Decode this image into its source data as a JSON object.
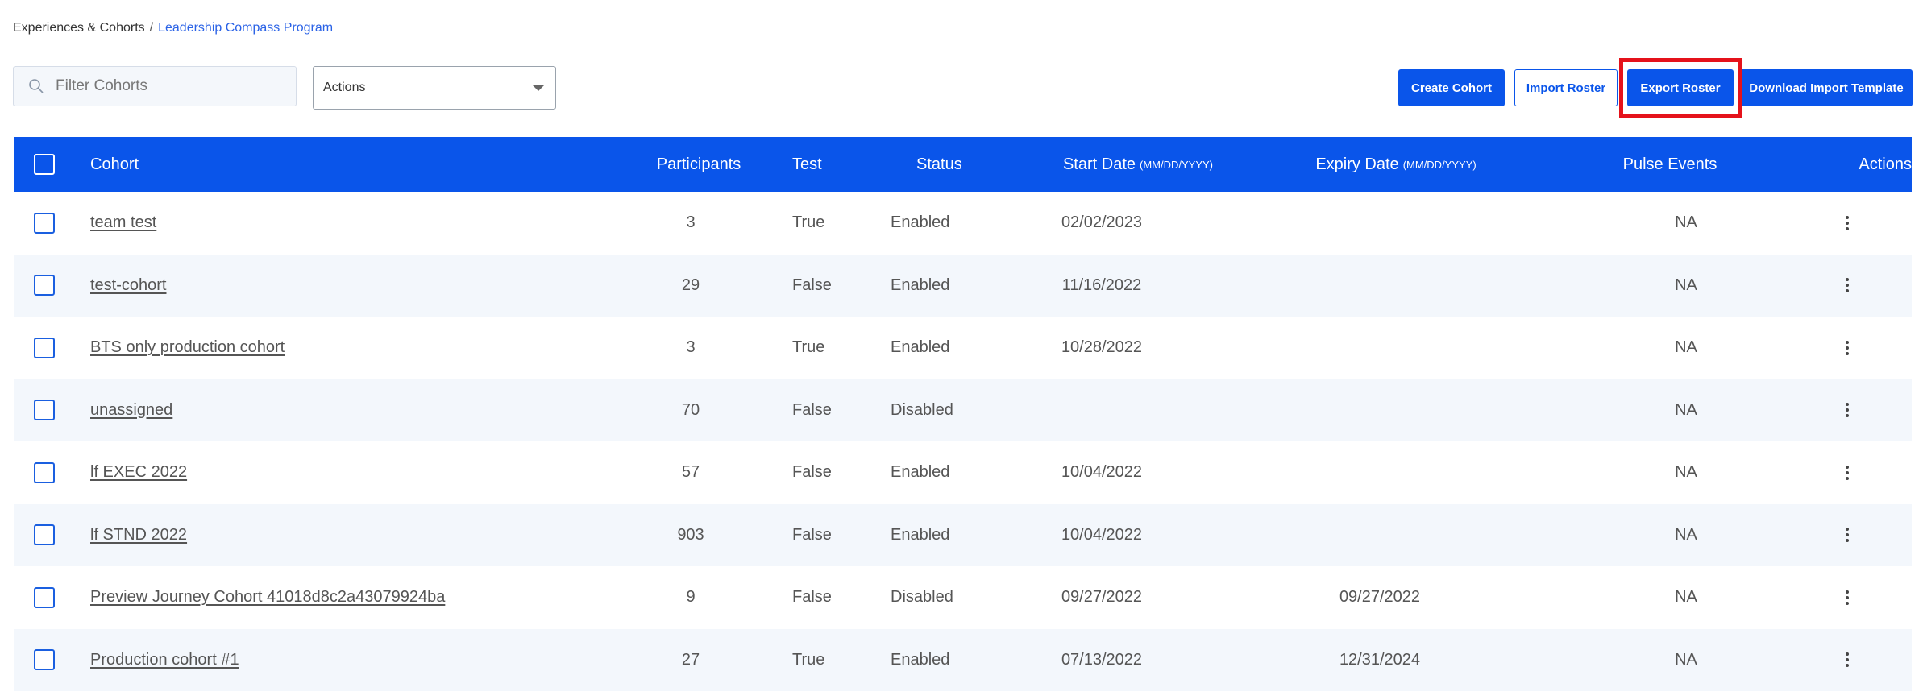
{
  "breadcrumb": {
    "parent": "Experiences & Cohorts",
    "separator": "/",
    "current": "Leadership Compass Program"
  },
  "filter": {
    "placeholder": "Filter Cohorts",
    "value": ""
  },
  "actions_select": {
    "value": "Actions"
  },
  "toolbar": {
    "create_label": "Create Cohort",
    "import_label": "Import Roster",
    "export_label": "Export Roster",
    "download_label": "Download Import Template"
  },
  "table": {
    "headers": {
      "cohort": "Cohort",
      "participants": "Participants",
      "test": "Test",
      "status": "Status",
      "start_date": "Start Date",
      "start_date_hint": "(MM/DD/YYYY)",
      "expiry_date": "Expiry Date",
      "expiry_date_hint": "(MM/DD/YYYY)",
      "pulse_events": "Pulse Events",
      "actions": "Actions"
    },
    "rows": [
      {
        "cohort": "team test",
        "participants": "3",
        "test": "True",
        "status": "Enabled",
        "start": "02/02/2023",
        "expiry": "",
        "pulse": "NA"
      },
      {
        "cohort": "test-cohort",
        "participants": "29",
        "test": "False",
        "status": "Enabled",
        "start": "11/16/2022",
        "expiry": "",
        "pulse": "NA"
      },
      {
        "cohort": "BTS only production cohort",
        "participants": "3",
        "test": "True",
        "status": "Enabled",
        "start": "10/28/2022",
        "expiry": "",
        "pulse": "NA"
      },
      {
        "cohort": "unassigned",
        "participants": "70",
        "test": "False",
        "status": "Disabled",
        "start": "",
        "expiry": "",
        "pulse": "NA"
      },
      {
        "cohort": "lf EXEC 2022",
        "participants": "57",
        "test": "False",
        "status": "Enabled",
        "start": "10/04/2022",
        "expiry": "",
        "pulse": "NA"
      },
      {
        "cohort": "lf STND 2022",
        "participants": "903",
        "test": "False",
        "status": "Enabled",
        "start": "10/04/2022",
        "expiry": "",
        "pulse": "NA"
      },
      {
        "cohort": "Preview Journey Cohort 41018d8c2a43079924ba",
        "participants": "9",
        "test": "False",
        "status": "Disabled",
        "start": "09/27/2022",
        "expiry": "09/27/2022",
        "pulse": "NA"
      },
      {
        "cohort": "Production cohort #1",
        "participants": "27",
        "test": "True",
        "status": "Enabled",
        "start": "07/13/2022",
        "expiry": "12/31/2024",
        "pulse": "NA"
      }
    ]
  },
  "colors": {
    "primary": "#0a55ea",
    "highlight": "#e5121b",
    "row_alt": "#f3f7fc"
  }
}
